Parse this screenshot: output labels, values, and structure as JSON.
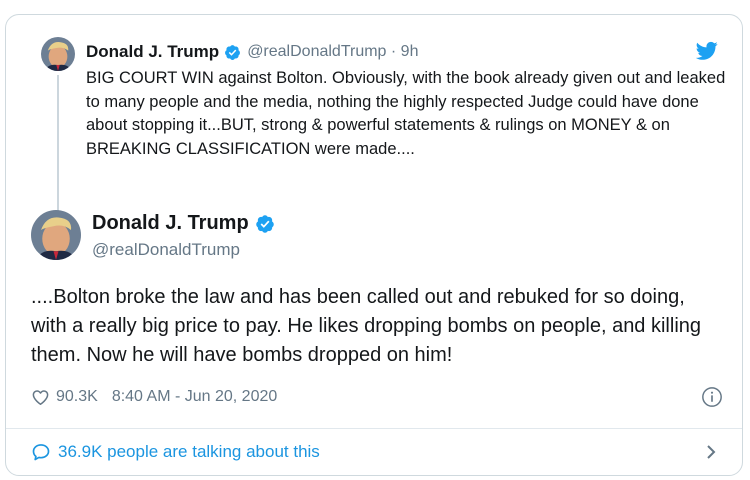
{
  "parent": {
    "name": "Donald J. Trump",
    "handle_time": "@realDonaldTrump · 9h",
    "text": "BIG COURT WIN against Bolton. Obviously, with the book already given out and leaked to many people and the media, nothing the highly respected Judge could have done about stopping it...BUT, strong & powerful statements & rulings on MONEY & on BREAKING CLASSIFICATION were made...."
  },
  "main": {
    "name": "Donald J. Trump",
    "handle": "@realDonaldTrump",
    "text": "....Bolton broke the law and has been called out and rebuked for so doing, with a really big price to pay. He likes dropping bombs on people, and killing them. Now he will have bombs dropped on him!"
  },
  "meta": {
    "likes": "90.3K",
    "timestamp": "8:40 AM - Jun 20, 2020"
  },
  "footer": {
    "talking": "36.9K people are talking about this"
  },
  "icons": {
    "brand": "twitter-bird-icon",
    "verified": "verified-badge-icon",
    "like": "heart-icon",
    "info": "info-icon",
    "conversation": "speech-bubble-icon",
    "more": "chevron-right-icon"
  },
  "colors": {
    "accent": "#1da1f2",
    "link": "#1b95e0",
    "secondary_text": "#657786",
    "border": "#cfd9de"
  }
}
